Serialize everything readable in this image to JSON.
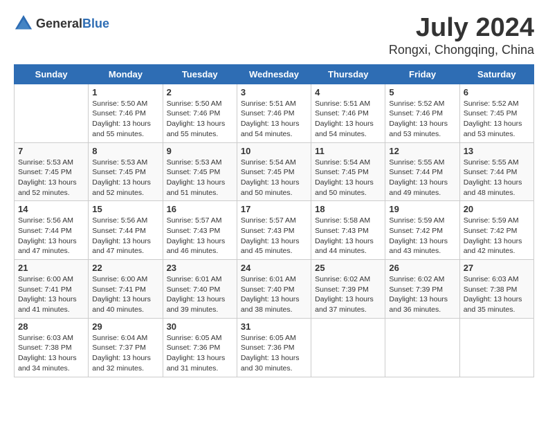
{
  "logo": {
    "text_general": "General",
    "text_blue": "Blue"
  },
  "title": "July 2024",
  "subtitle": "Rongxi, Chongqing, China",
  "days_of_week": [
    "Sunday",
    "Monday",
    "Tuesday",
    "Wednesday",
    "Thursday",
    "Friday",
    "Saturday"
  ],
  "weeks": [
    [
      {
        "day": "",
        "sunrise": "",
        "sunset": "",
        "daylight": ""
      },
      {
        "day": "1",
        "sunrise": "Sunrise: 5:50 AM",
        "sunset": "Sunset: 7:46 PM",
        "daylight": "Daylight: 13 hours and 55 minutes."
      },
      {
        "day": "2",
        "sunrise": "Sunrise: 5:50 AM",
        "sunset": "Sunset: 7:46 PM",
        "daylight": "Daylight: 13 hours and 55 minutes."
      },
      {
        "day": "3",
        "sunrise": "Sunrise: 5:51 AM",
        "sunset": "Sunset: 7:46 PM",
        "daylight": "Daylight: 13 hours and 54 minutes."
      },
      {
        "day": "4",
        "sunrise": "Sunrise: 5:51 AM",
        "sunset": "Sunset: 7:46 PM",
        "daylight": "Daylight: 13 hours and 54 minutes."
      },
      {
        "day": "5",
        "sunrise": "Sunrise: 5:52 AM",
        "sunset": "Sunset: 7:46 PM",
        "daylight": "Daylight: 13 hours and 53 minutes."
      },
      {
        "day": "6",
        "sunrise": "Sunrise: 5:52 AM",
        "sunset": "Sunset: 7:45 PM",
        "daylight": "Daylight: 13 hours and 53 minutes."
      }
    ],
    [
      {
        "day": "7",
        "sunrise": "Sunrise: 5:53 AM",
        "sunset": "Sunset: 7:45 PM",
        "daylight": "Daylight: 13 hours and 52 minutes."
      },
      {
        "day": "8",
        "sunrise": "Sunrise: 5:53 AM",
        "sunset": "Sunset: 7:45 PM",
        "daylight": "Daylight: 13 hours and 52 minutes."
      },
      {
        "day": "9",
        "sunrise": "Sunrise: 5:53 AM",
        "sunset": "Sunset: 7:45 PM",
        "daylight": "Daylight: 13 hours and 51 minutes."
      },
      {
        "day": "10",
        "sunrise": "Sunrise: 5:54 AM",
        "sunset": "Sunset: 7:45 PM",
        "daylight": "Daylight: 13 hours and 50 minutes."
      },
      {
        "day": "11",
        "sunrise": "Sunrise: 5:54 AM",
        "sunset": "Sunset: 7:45 PM",
        "daylight": "Daylight: 13 hours and 50 minutes."
      },
      {
        "day": "12",
        "sunrise": "Sunrise: 5:55 AM",
        "sunset": "Sunset: 7:44 PM",
        "daylight": "Daylight: 13 hours and 49 minutes."
      },
      {
        "day": "13",
        "sunrise": "Sunrise: 5:55 AM",
        "sunset": "Sunset: 7:44 PM",
        "daylight": "Daylight: 13 hours and 48 minutes."
      }
    ],
    [
      {
        "day": "14",
        "sunrise": "Sunrise: 5:56 AM",
        "sunset": "Sunset: 7:44 PM",
        "daylight": "Daylight: 13 hours and 47 minutes."
      },
      {
        "day": "15",
        "sunrise": "Sunrise: 5:56 AM",
        "sunset": "Sunset: 7:44 PM",
        "daylight": "Daylight: 13 hours and 47 minutes."
      },
      {
        "day": "16",
        "sunrise": "Sunrise: 5:57 AM",
        "sunset": "Sunset: 7:43 PM",
        "daylight": "Daylight: 13 hours and 46 minutes."
      },
      {
        "day": "17",
        "sunrise": "Sunrise: 5:57 AM",
        "sunset": "Sunset: 7:43 PM",
        "daylight": "Daylight: 13 hours and 45 minutes."
      },
      {
        "day": "18",
        "sunrise": "Sunrise: 5:58 AM",
        "sunset": "Sunset: 7:43 PM",
        "daylight": "Daylight: 13 hours and 44 minutes."
      },
      {
        "day": "19",
        "sunrise": "Sunrise: 5:59 AM",
        "sunset": "Sunset: 7:42 PM",
        "daylight": "Daylight: 13 hours and 43 minutes."
      },
      {
        "day": "20",
        "sunrise": "Sunrise: 5:59 AM",
        "sunset": "Sunset: 7:42 PM",
        "daylight": "Daylight: 13 hours and 42 minutes."
      }
    ],
    [
      {
        "day": "21",
        "sunrise": "Sunrise: 6:00 AM",
        "sunset": "Sunset: 7:41 PM",
        "daylight": "Daylight: 13 hours and 41 minutes."
      },
      {
        "day": "22",
        "sunrise": "Sunrise: 6:00 AM",
        "sunset": "Sunset: 7:41 PM",
        "daylight": "Daylight: 13 hours and 40 minutes."
      },
      {
        "day": "23",
        "sunrise": "Sunrise: 6:01 AM",
        "sunset": "Sunset: 7:40 PM",
        "daylight": "Daylight: 13 hours and 39 minutes."
      },
      {
        "day": "24",
        "sunrise": "Sunrise: 6:01 AM",
        "sunset": "Sunset: 7:40 PM",
        "daylight": "Daylight: 13 hours and 38 minutes."
      },
      {
        "day": "25",
        "sunrise": "Sunrise: 6:02 AM",
        "sunset": "Sunset: 7:39 PM",
        "daylight": "Daylight: 13 hours and 37 minutes."
      },
      {
        "day": "26",
        "sunrise": "Sunrise: 6:02 AM",
        "sunset": "Sunset: 7:39 PM",
        "daylight": "Daylight: 13 hours and 36 minutes."
      },
      {
        "day": "27",
        "sunrise": "Sunrise: 6:03 AM",
        "sunset": "Sunset: 7:38 PM",
        "daylight": "Daylight: 13 hours and 35 minutes."
      }
    ],
    [
      {
        "day": "28",
        "sunrise": "Sunrise: 6:03 AM",
        "sunset": "Sunset: 7:38 PM",
        "daylight": "Daylight: 13 hours and 34 minutes."
      },
      {
        "day": "29",
        "sunrise": "Sunrise: 6:04 AM",
        "sunset": "Sunset: 7:37 PM",
        "daylight": "Daylight: 13 hours and 32 minutes."
      },
      {
        "day": "30",
        "sunrise": "Sunrise: 6:05 AM",
        "sunset": "Sunset: 7:36 PM",
        "daylight": "Daylight: 13 hours and 31 minutes."
      },
      {
        "day": "31",
        "sunrise": "Sunrise: 6:05 AM",
        "sunset": "Sunset: 7:36 PM",
        "daylight": "Daylight: 13 hours and 30 minutes."
      },
      {
        "day": "",
        "sunrise": "",
        "sunset": "",
        "daylight": ""
      },
      {
        "day": "",
        "sunrise": "",
        "sunset": "",
        "daylight": ""
      },
      {
        "day": "",
        "sunrise": "",
        "sunset": "",
        "daylight": ""
      }
    ]
  ]
}
